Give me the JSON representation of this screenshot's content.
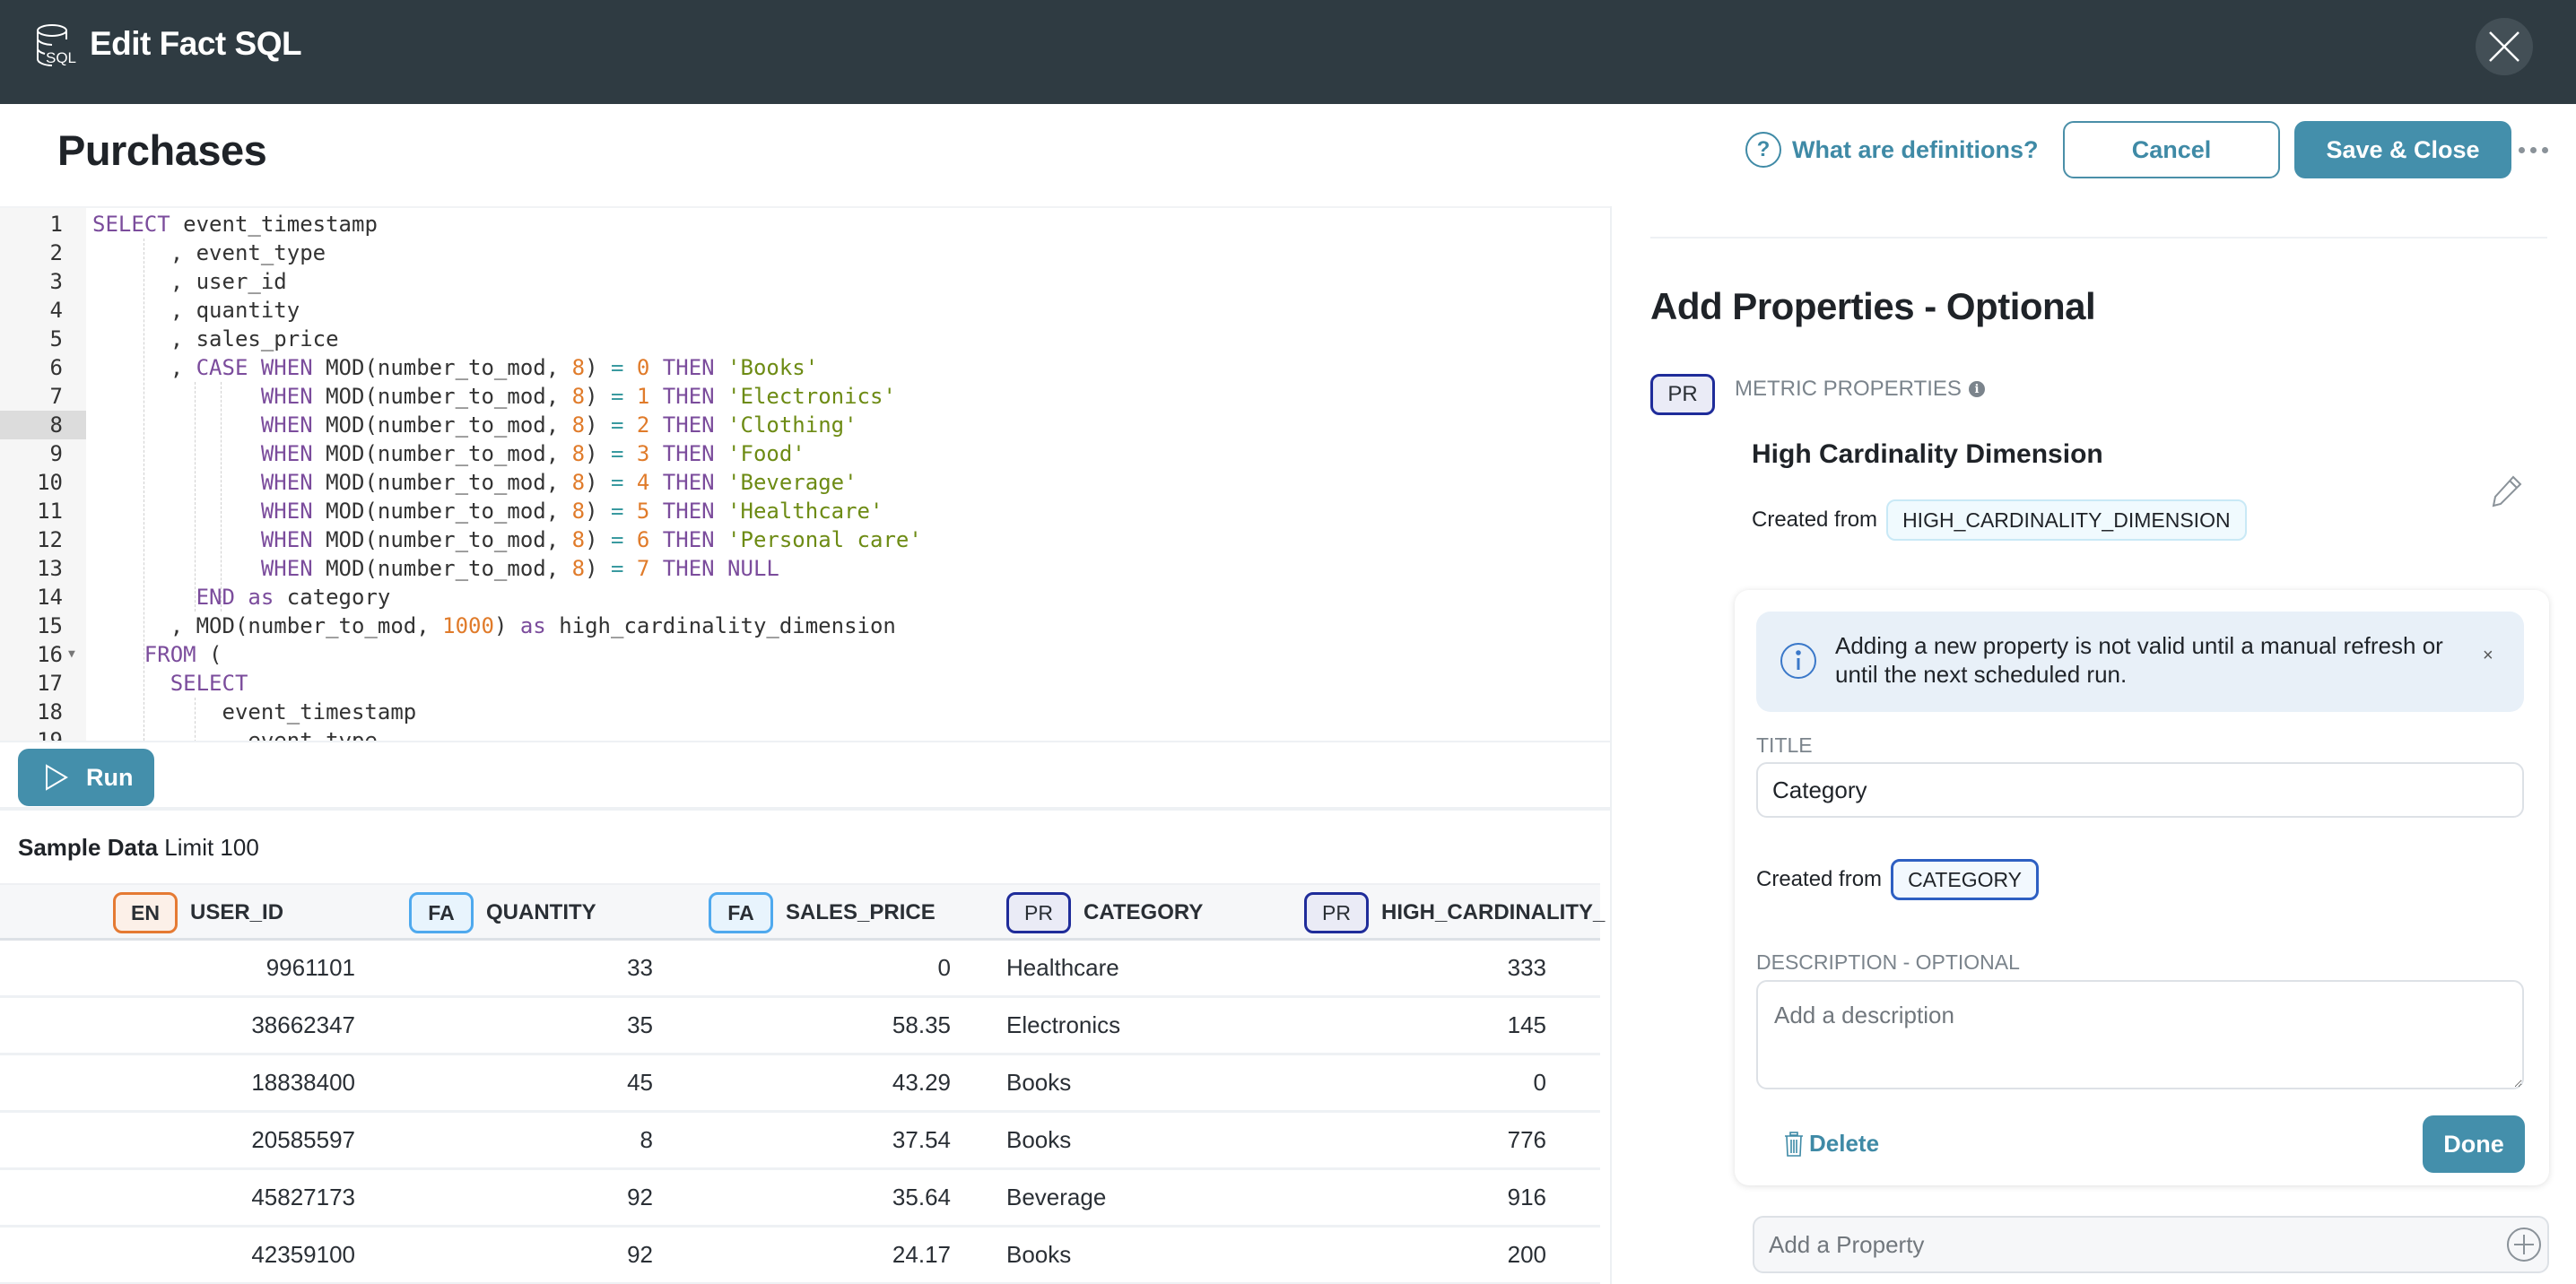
{
  "header": {
    "title": "Edit Fact SQL",
    "icon": "database-sql-icon",
    "close_icon": "close-icon"
  },
  "subheader": {
    "page_title": "Purchases",
    "help_link": "What are definitions?",
    "cancel_label": "Cancel",
    "save_label": "Save & Close",
    "more_icon": "more-horizontal-icon"
  },
  "editor": {
    "active_line": 8,
    "lines": [
      "SELECT event_timestamp",
      "      , event_type",
      "      , user_id",
      "      , quantity",
      "      , sales_price",
      "      , CASE WHEN MOD(number_to_mod, 8) = 0 THEN 'Books'",
      "             WHEN MOD(number_to_mod, 8) = 1 THEN 'Electronics'",
      "             WHEN MOD(number_to_mod, 8) = 2 THEN 'Clothing'",
      "             WHEN MOD(number_to_mod, 8) = 3 THEN 'Food'",
      "             WHEN MOD(number_to_mod, 8) = 4 THEN 'Beverage'",
      "             WHEN MOD(number_to_mod, 8) = 5 THEN 'Healthcare'",
      "             WHEN MOD(number_to_mod, 8) = 6 THEN 'Personal care'",
      "             WHEN MOD(number_to_mod, 8) = 7 THEN NULL",
      "        END as category",
      "      , MOD(number_to_mod, 1000) as high_cardinality_dimension",
      "    FROM (",
      "      SELECT",
      "          event_timestamp",
      "          , event_type"
    ],
    "fold_lines": [
      16
    ]
  },
  "run_button": {
    "label": "Run",
    "icon": "play-icon"
  },
  "sample_data": {
    "title_bold": "Sample Data",
    "title_rest": " Limit 100",
    "columns": [
      {
        "badge": "EN",
        "type": "en",
        "name": "USER_ID",
        "align": "right"
      },
      {
        "badge": "FA",
        "type": "fa",
        "name": "QUANTITY",
        "align": "right"
      },
      {
        "badge": "FA",
        "type": "fa",
        "name": "SALES_PRICE",
        "align": "right"
      },
      {
        "badge": "PR",
        "type": "pr",
        "name": "CATEGORY",
        "align": "left"
      },
      {
        "badge": "PR",
        "type": "pr",
        "name": "HIGH_CARDINALITY_",
        "align": "right"
      }
    ],
    "rows": [
      [
        "9961101",
        "33",
        "0",
        "Healthcare",
        "333"
      ],
      [
        "38662347",
        "35",
        "58.35",
        "Electronics",
        "145"
      ],
      [
        "18838400",
        "45",
        "43.29",
        "Books",
        "0"
      ],
      [
        "20585597",
        "8",
        "37.54",
        "Books",
        "776"
      ],
      [
        "45827173",
        "92",
        "35.64",
        "Beverage",
        "916"
      ],
      [
        "42359100",
        "92",
        "24.17",
        "Books",
        "200"
      ]
    ]
  },
  "properties_panel": {
    "title": "Add Properties - Optional",
    "badge": "PR",
    "section_label": "METRIC PROPERTIES",
    "existing_property": {
      "name": "High Cardinality Dimension",
      "created_from_label": "Created from",
      "created_from_value": "HIGH_CARDINALITY_DIMENSION",
      "edit_icon": "pencil-icon"
    },
    "editor_card": {
      "alert_text": "Adding a new property is not valid until a manual refresh or until the next scheduled run.",
      "alert_close": "×",
      "title_label": "TITLE",
      "title_value": "Category",
      "created_from_label": "Created from",
      "created_from_value": "CATEGORY",
      "description_label": "DESCRIPTION - OPTIONAL",
      "description_placeholder": "Add a description",
      "delete_label": "Delete",
      "done_label": "Done"
    },
    "add_property_placeholder": "Add a Property"
  },
  "colors": {
    "header_bg": "#2f3b42",
    "accent": "#448fab",
    "badge_en": "#e57a33",
    "badge_fa": "#4fa9ee",
    "badge_pr": "#1f2c9a",
    "sql_keyword": "#7b4c9c",
    "sql_number": "#e07b2a",
    "sql_string": "#6d8b14"
  }
}
